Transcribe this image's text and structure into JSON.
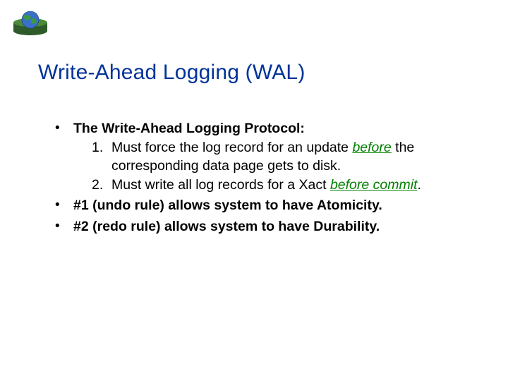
{
  "logo_alt": "database-globe-logo",
  "title": "Write-Ahead Logging (WAL)",
  "bullet1": {
    "intro_a": "The ",
    "intro_strong": "Write-Ahead Logging",
    "intro_b": " Protocol:",
    "items": [
      {
        "num": "1.",
        "a": " Must force the log record for an update ",
        "em": "before",
        "b": " the corresponding data page gets to disk."
      },
      {
        "num": "2.",
        "a": " Must write all log records for a Xact ",
        "em": "before commit",
        "b": "."
      }
    ]
  },
  "bullet2": "#1 (undo rule) allows system to have Atomicity.",
  "bullet3": "#2 (redo rule) allows system to have Durability."
}
